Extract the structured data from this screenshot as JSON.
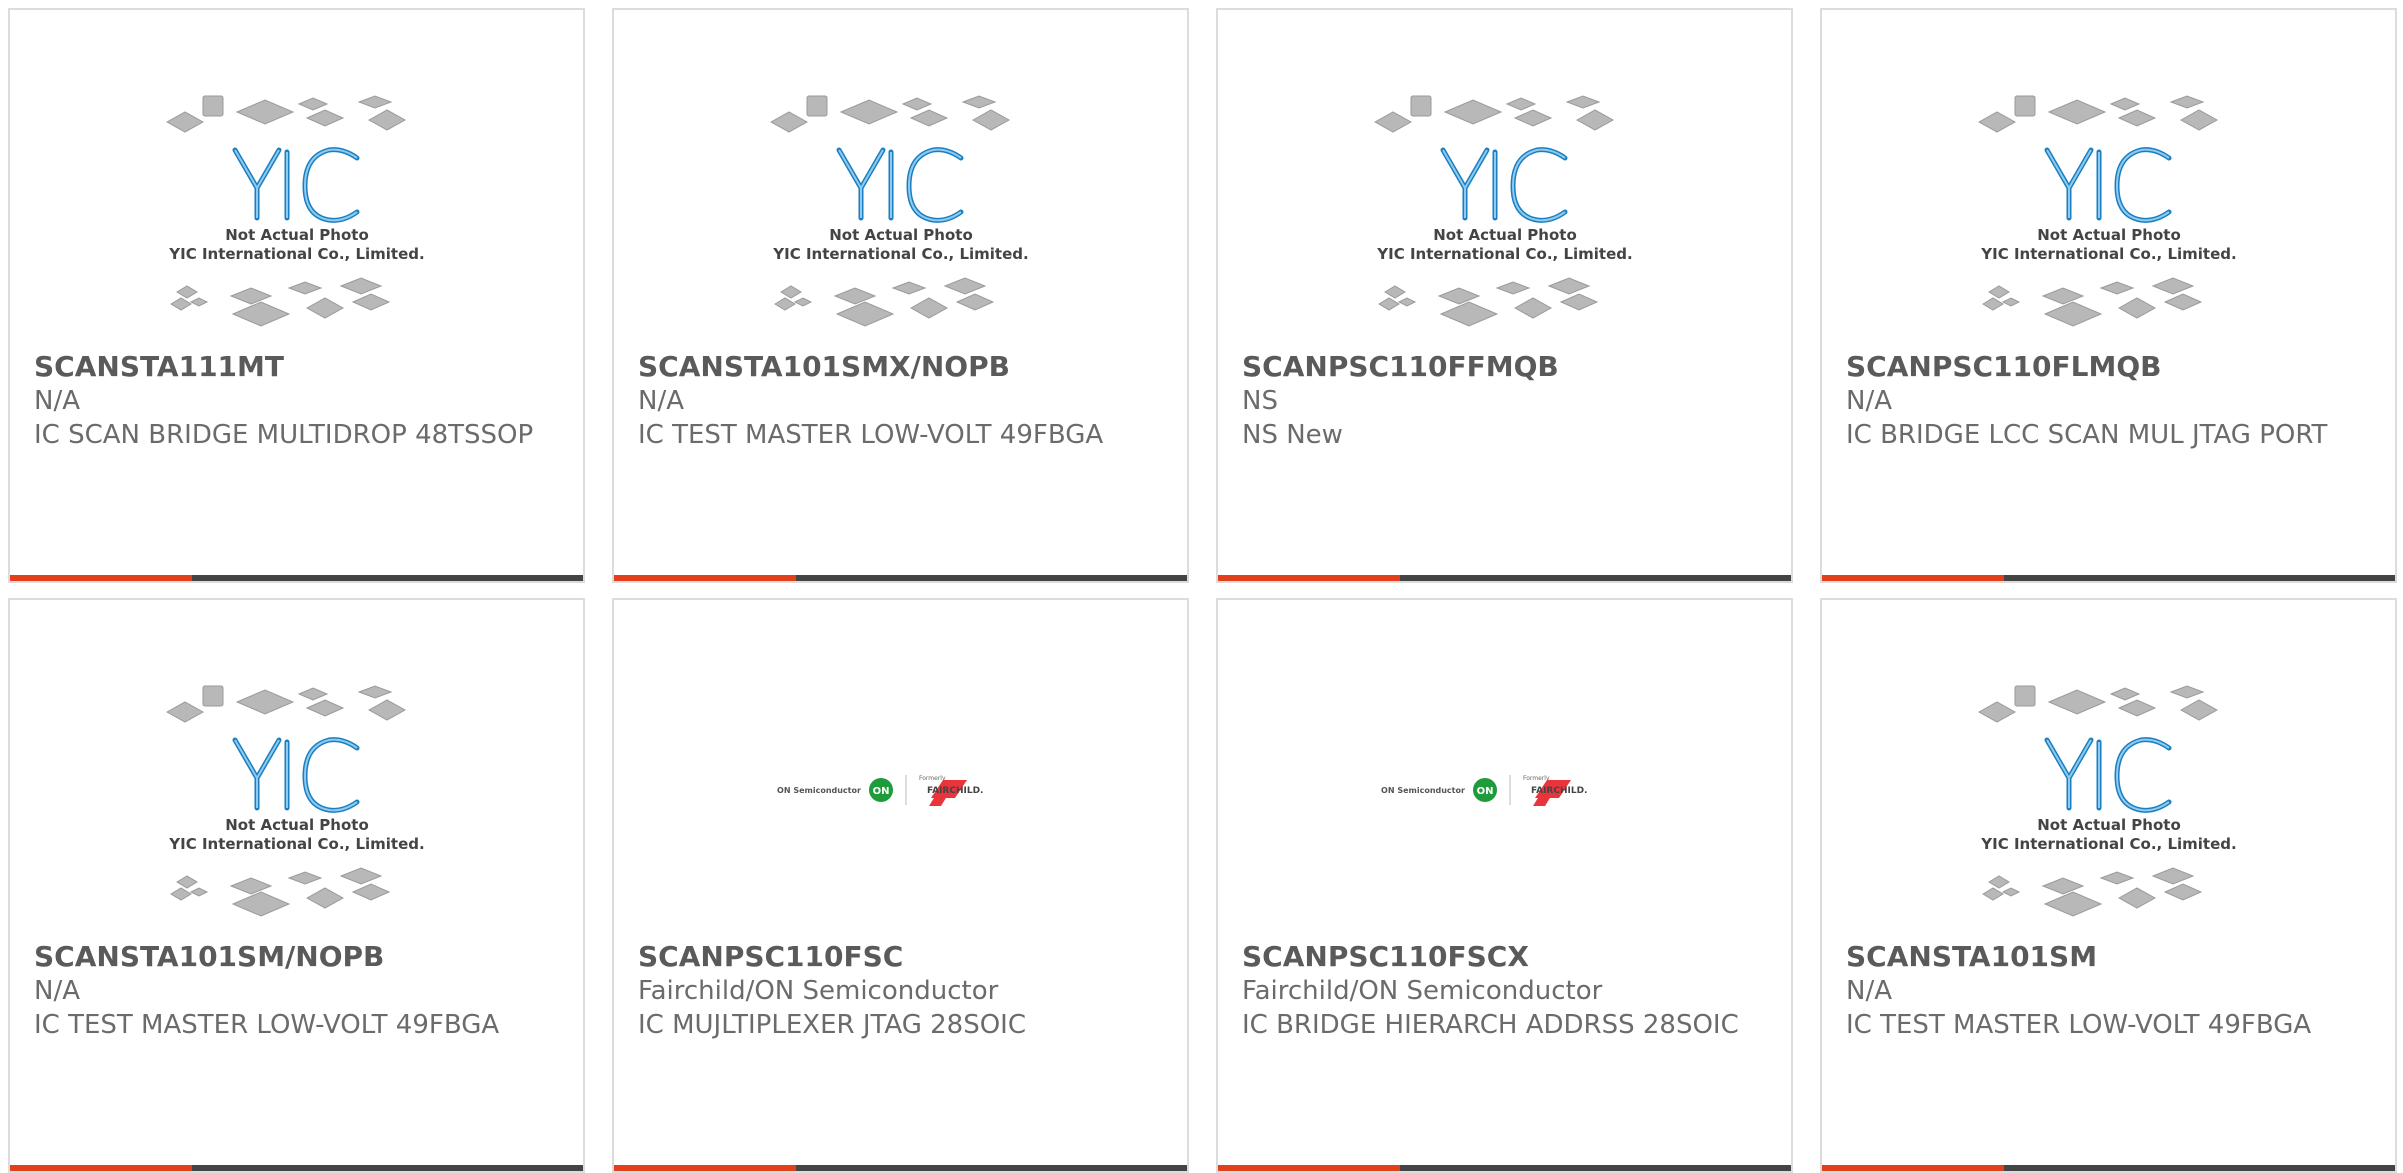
{
  "placeholder_caption": {
    "line1": "Not Actual Photo",
    "line2": "YIC International Co., Limited.",
    "logo_text": "YIC"
  },
  "brand_logo": {
    "left": "ON Semiconductor",
    "mid": "ON",
    "right_small": "Formerly",
    "right": "FAIRCHILD."
  },
  "colors": {
    "accent": "#e2401c",
    "bar": "#444444",
    "border": "#dcdcdc",
    "text": "#6b6b6b"
  },
  "products": [
    {
      "part": "SCANSTA111MT",
      "maker": "N/A",
      "desc": "IC SCAN BRIDGE MULTIDROP 48TSSOP",
      "image": "yic-placeholder-icon"
    },
    {
      "part": "SCANSTA101SMX/NOPB",
      "maker": "N/A",
      "desc": "IC TEST MASTER LOW-VOLT 49FBGA",
      "image": "yic-placeholder-icon"
    },
    {
      "part": "SCANPSC110FFMQB",
      "maker": "NS",
      "desc": "NS New",
      "image": "yic-placeholder-icon"
    },
    {
      "part": "SCANPSC110FLMQB",
      "maker": "N/A",
      "desc": "IC BRIDGE LCC SCAN MUL JTAG PORT",
      "image": "yic-placeholder-icon"
    },
    {
      "part": "SCANSTA101SM/NOPB",
      "maker": "N/A",
      "desc": "IC TEST MASTER LOW-VOLT 49FBGA",
      "image": "yic-placeholder-icon"
    },
    {
      "part": "SCANPSC110FSC",
      "maker": "Fairchild/ON Semiconductor",
      "desc": "IC MUJLTIPLEXER JTAG 28SOIC",
      "image": "on-fairchild-logo"
    },
    {
      "part": "SCANPSC110FSCX",
      "maker": "Fairchild/ON Semiconductor",
      "desc": "IC BRIDGE HIERARCH ADDRSS 28SOIC",
      "image": "on-fairchild-logo"
    },
    {
      "part": "SCANSTA101SM",
      "maker": "N/A",
      "desc": "IC TEST MASTER LOW-VOLT 49FBGA",
      "image": "yic-placeholder-icon"
    }
  ]
}
